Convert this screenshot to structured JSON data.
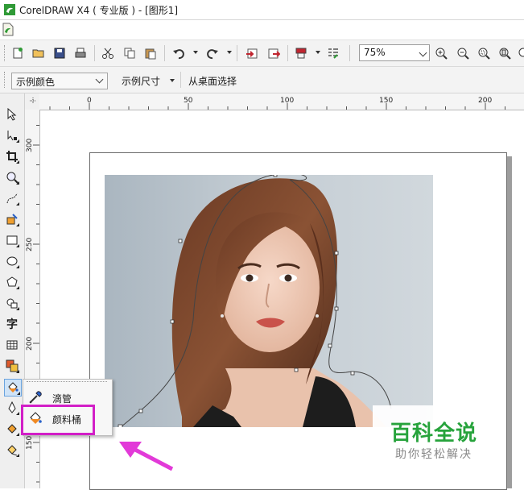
{
  "window": {
    "title": "CorelDRAW X4 ( 专业版 ) - [图形1]"
  },
  "standard_toolbar": {
    "zoom_level": "75%",
    "icons": [
      "new-icon",
      "open-icon",
      "save-icon",
      "print-icon",
      "cut-icon",
      "copy-icon",
      "paste-icon",
      "undo-icon",
      "redo-icon",
      "import-icon",
      "export-icon",
      "application-launcher-icon",
      "welcome-screen-icon",
      "zoom-in-icon",
      "zoom-out-icon",
      "zoom-fit-icon",
      "zoom-page-icon",
      "zoom-width-icon"
    ]
  },
  "property_bar": {
    "color_select": "示例颜色",
    "size_label": "示例尺寸",
    "select_from_desktop": "从桌面选择"
  },
  "rulers": {
    "horizontal_ticks": [
      "0",
      "50",
      "100",
      "150",
      "200"
    ],
    "vertical_ticks": [
      "300",
      "250",
      "200",
      "150"
    ]
  },
  "toolbox": {
    "text_tool_glyph": "字",
    "tools": [
      "pick-tool-icon",
      "shape-tool-icon",
      "crop-tool-icon",
      "zoom-tool-icon",
      "freehand-tool-icon",
      "smart-fill-icon",
      "rectangle-tool-icon",
      "ellipse-tool-icon",
      "polygon-tool-icon",
      "basic-shapes-icon",
      "text-tool-icon",
      "table-tool-icon",
      "interactive-tool-icon",
      "eyedropper-bucket-tool-icon",
      "outline-tool-icon",
      "fill-tool-icon",
      "interactive-fill-icon"
    ]
  },
  "flyout": {
    "items": [
      {
        "label": "滴管",
        "icon": "eyedropper-icon"
      },
      {
        "label": "颜料桶",
        "icon": "paint-bucket-icon"
      }
    ]
  },
  "watermark": {
    "main": "百科全说",
    "sub": "助你轻松解决"
  },
  "colors": {
    "highlight": "#d21fc7",
    "arrow": "#e23ad8",
    "watermark_green": "#27a33c",
    "active_tool": "#cfe3f7"
  }
}
